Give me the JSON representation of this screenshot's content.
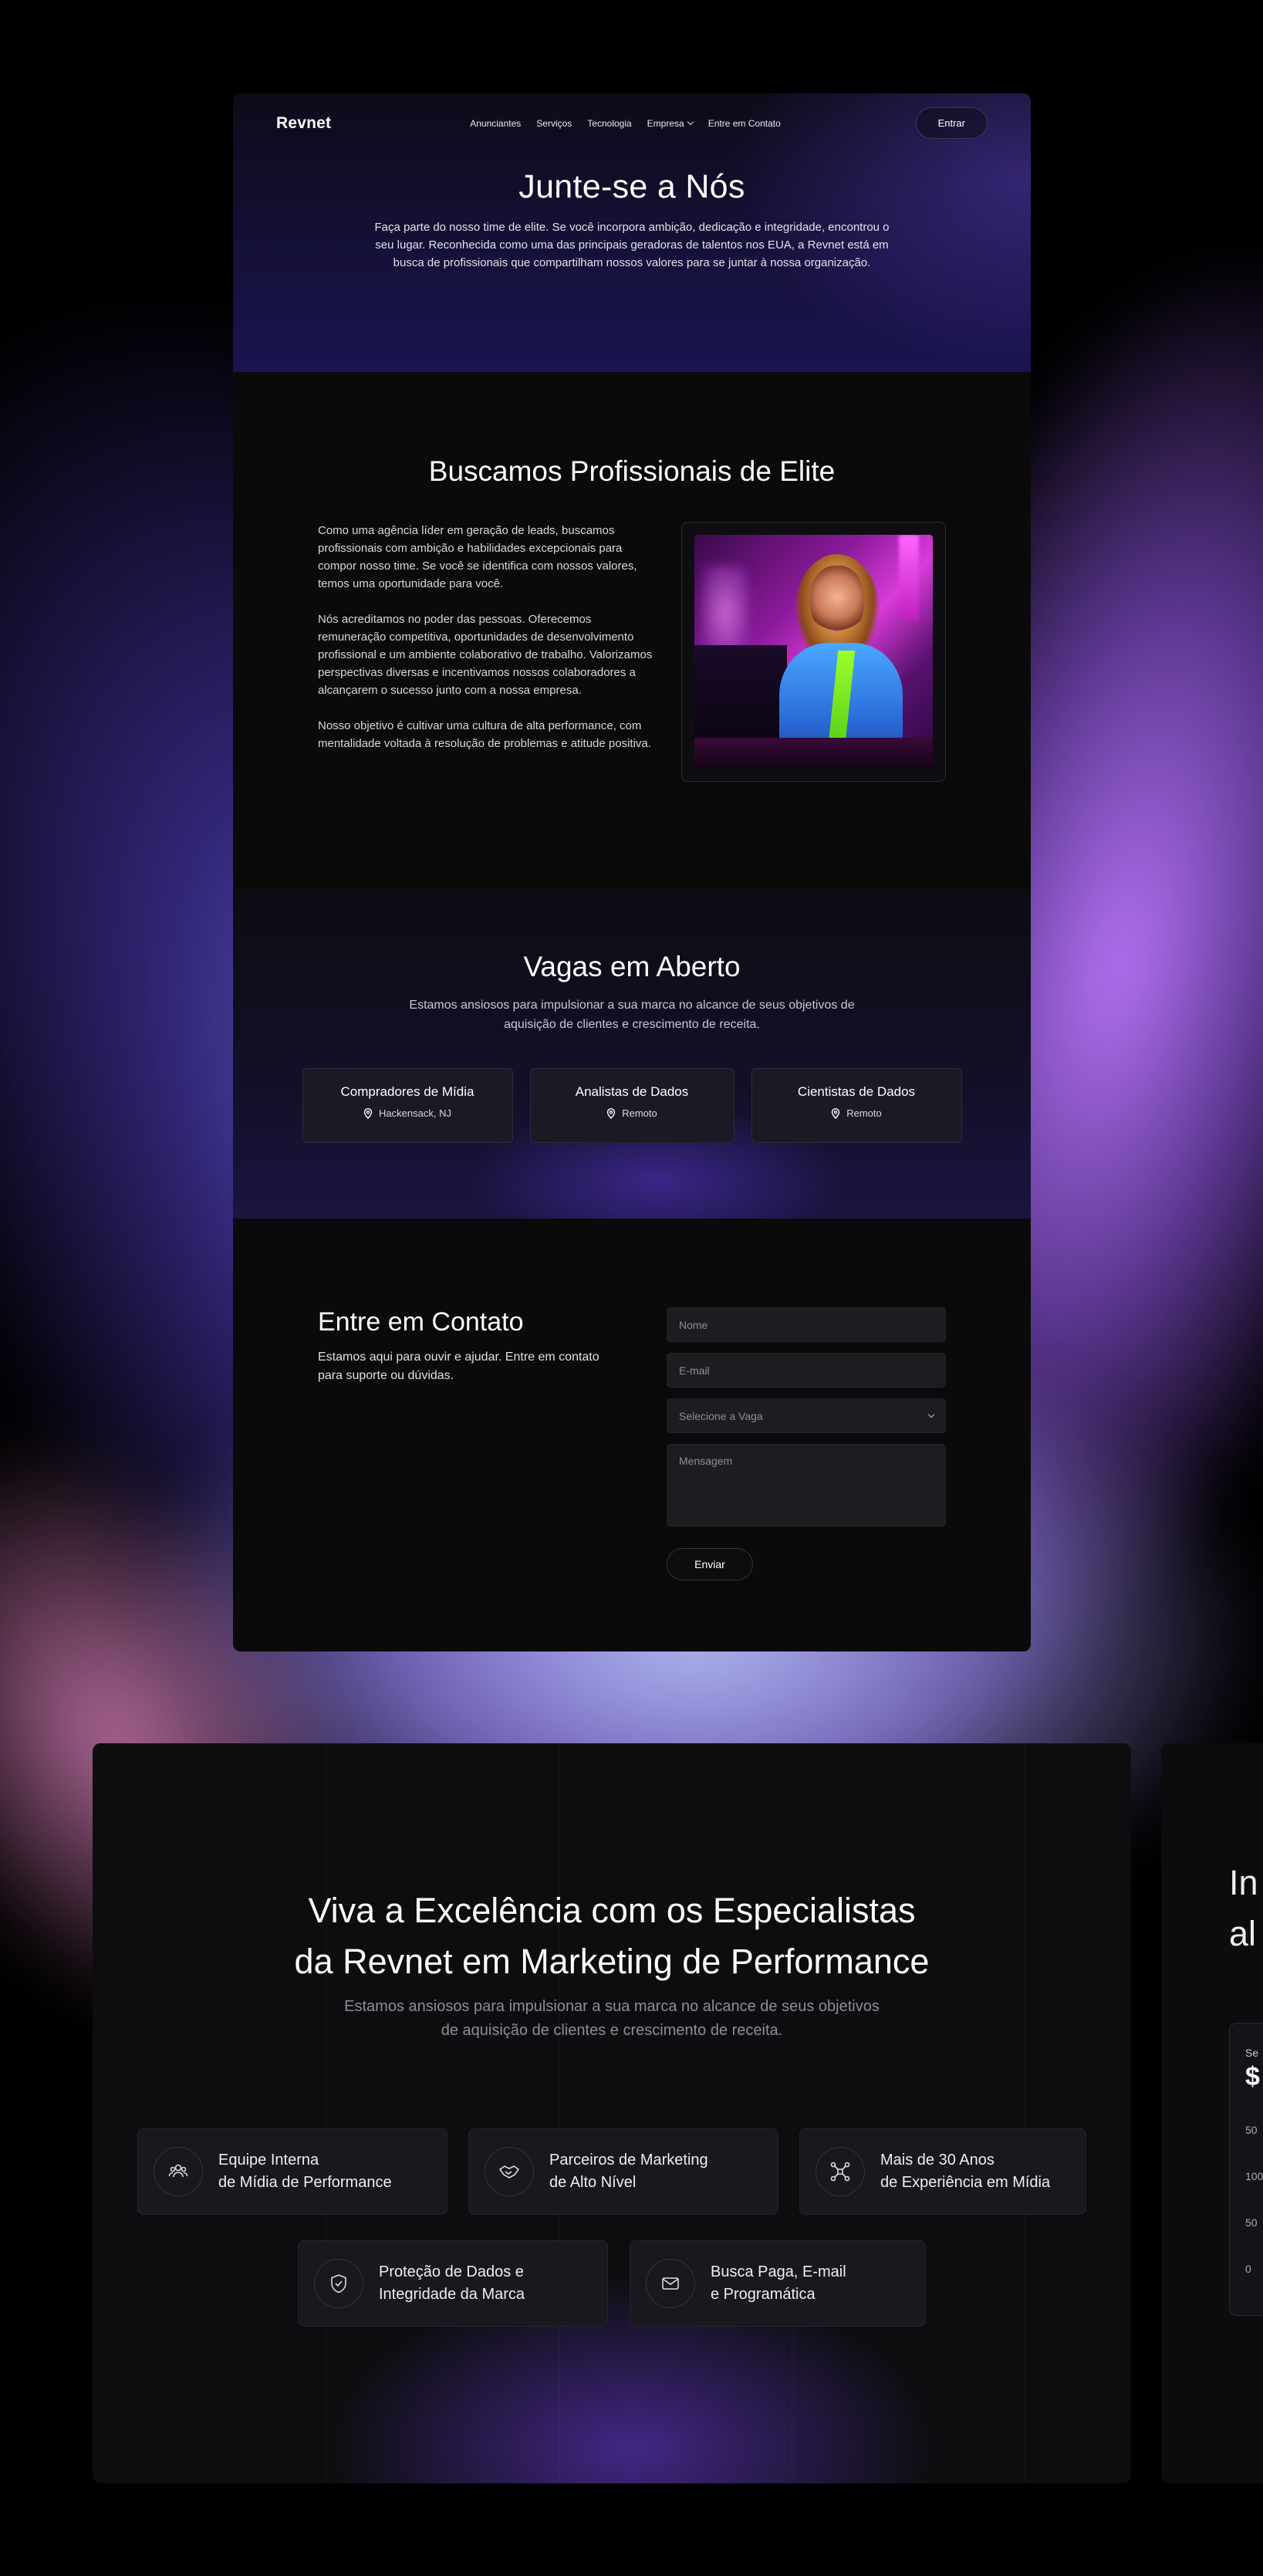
{
  "nav": {
    "logo": "Revnet",
    "items": [
      "Anunciantes",
      "Serviços",
      "Tecnologia",
      "Empresa",
      "Entre em Contato"
    ],
    "login": "Entrar"
  },
  "hero": {
    "title": "Junte-se a Nós",
    "text": "Faça parte do nosso time de elite. Se você incorpora ambição, dedicação e integridade, encontrou o seu lugar. Reconhecida como uma das principais geradoras de talentos nos EUA, a Revnet está em busca de profissionais que compartilham nossos valores para se juntar à nossa organização."
  },
  "elite": {
    "title": "Buscamos Profissionais de Elite",
    "paragraphs": [
      "Como uma agência líder em geração de leads, buscamos profissionais com ambição e habilidades excepcionais para compor nosso time. Se você se identifica com nossos valores, temos uma oportunidade para você.",
      "Nós acreditamos no poder das pessoas. Oferecemos remuneração competitiva, oportunidades de desenvolvimento profissional e um ambiente colaborativo de trabalho. Valorizamos perspectivas diversas e incentivamos nossos colaboradores a alcançarem o sucesso junto com a nossa empresa.",
      "Nosso objetivo é cultivar uma cultura de alta performance, com mentalidade voltada à resolução de problemas e atitude positiva."
    ]
  },
  "jobs": {
    "title": "Vagas em Aberto",
    "subtitle": "Estamos ansiosos para impulsionar a sua marca no alcance de seus objetivos de aquisição de clientes e crescimento de receita.",
    "items": [
      {
        "title": "Compradores de Mídia",
        "location": "Hackensack, NJ"
      },
      {
        "title": "Analistas de Dados",
        "location": "Remoto"
      },
      {
        "title": "Cientistas de Dados",
        "location": "Remoto"
      }
    ]
  },
  "contact": {
    "title": "Entre em Contato",
    "text": "Estamos aqui para ouvir e ajudar. Entre em contato para suporte ou dúvidas.",
    "name_placeholder": "Nome",
    "email_placeholder": "E-mail",
    "select_placeholder": "Selecione a Vaga",
    "message_placeholder": "Mensagem",
    "submit": "Enviar"
  },
  "excellence": {
    "title_line1": "Viva a Excelência com os Especialistas",
    "title_line2": "da Revnet em Marketing de Performance",
    "subtitle": "Estamos ansiosos para impulsionar a sua marca no alcance de seus objetivos de aquisição de clientes e crescimento de receita.",
    "features": [
      {
        "text": "Equipe Interna\nde Mídia de Performance",
        "icon": "team-icon"
      },
      {
        "text": "Parceiros de Marketing\nde Alto Nível",
        "icon": "handshake-icon"
      },
      {
        "text": "Mais de 30 Anos\nde Experiência em Mídia",
        "icon": "network-icon"
      },
      {
        "text": "Proteção de Dados e\nIntegridade da Marca",
        "icon": "shield-icon"
      },
      {
        "text": "Busca Paga, E-mail\ne Programática",
        "icon": "mail-icon"
      }
    ]
  },
  "peek": {
    "title_line1": "In",
    "title_line2": "al",
    "label": "Se",
    "value": "$",
    "ticks": [
      "50",
      "100",
      "50",
      "0"
    ]
  },
  "colors": {
    "accent": "#7b5cff",
    "card_bg": "#0a0a0b",
    "glow": "#b07cff"
  }
}
